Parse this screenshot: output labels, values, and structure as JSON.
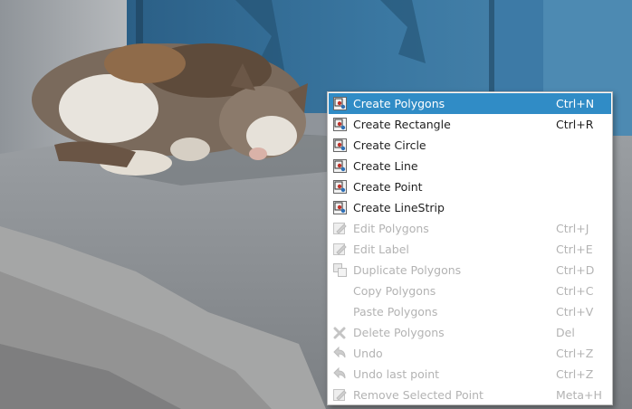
{
  "menu": {
    "items": [
      {
        "label": "Create Polygons",
        "shortcut": "Ctrl+N",
        "icon": "create-shape-icon",
        "enabled": true,
        "highlighted": true
      },
      {
        "label": "Create Rectangle",
        "shortcut": "Ctrl+R",
        "icon": "create-shape-icon",
        "enabled": true
      },
      {
        "label": "Create Circle",
        "shortcut": "",
        "icon": "create-shape-icon",
        "enabled": true
      },
      {
        "label": "Create Line",
        "shortcut": "",
        "icon": "create-shape-icon",
        "enabled": true
      },
      {
        "label": "Create Point",
        "shortcut": "",
        "icon": "create-shape-icon",
        "enabled": true
      },
      {
        "label": "Create LineStrip",
        "shortcut": "",
        "icon": "create-shape-icon",
        "enabled": true
      },
      {
        "label": "Edit Polygons",
        "shortcut": "Ctrl+J",
        "icon": "edit-icon",
        "enabled": false
      },
      {
        "label": "Edit Label",
        "shortcut": "Ctrl+E",
        "icon": "edit-icon",
        "enabled": false
      },
      {
        "label": "Duplicate Polygons",
        "shortcut": "Ctrl+D",
        "icon": "duplicate-icon",
        "enabled": false
      },
      {
        "label": "Copy Polygons",
        "shortcut": "Ctrl+C",
        "icon": "",
        "enabled": false
      },
      {
        "label": "Paste Polygons",
        "shortcut": "Ctrl+V",
        "icon": "",
        "enabled": false
      },
      {
        "label": "Delete Polygons",
        "shortcut": "Del",
        "icon": "delete-icon",
        "enabled": false
      },
      {
        "label": "Undo",
        "shortcut": "Ctrl+Z",
        "icon": "undo-icon",
        "enabled": false
      },
      {
        "label": "Undo last point",
        "shortcut": "Ctrl+Z",
        "icon": "undo-icon",
        "enabled": false
      },
      {
        "label": "Remove Selected Point",
        "shortcut": "Meta+H",
        "icon": "edit-icon",
        "enabled": false
      }
    ]
  },
  "colors": {
    "highlight": "#308cc6",
    "disabled_text": "#b3b3b3",
    "text": "#1f1f1f"
  }
}
